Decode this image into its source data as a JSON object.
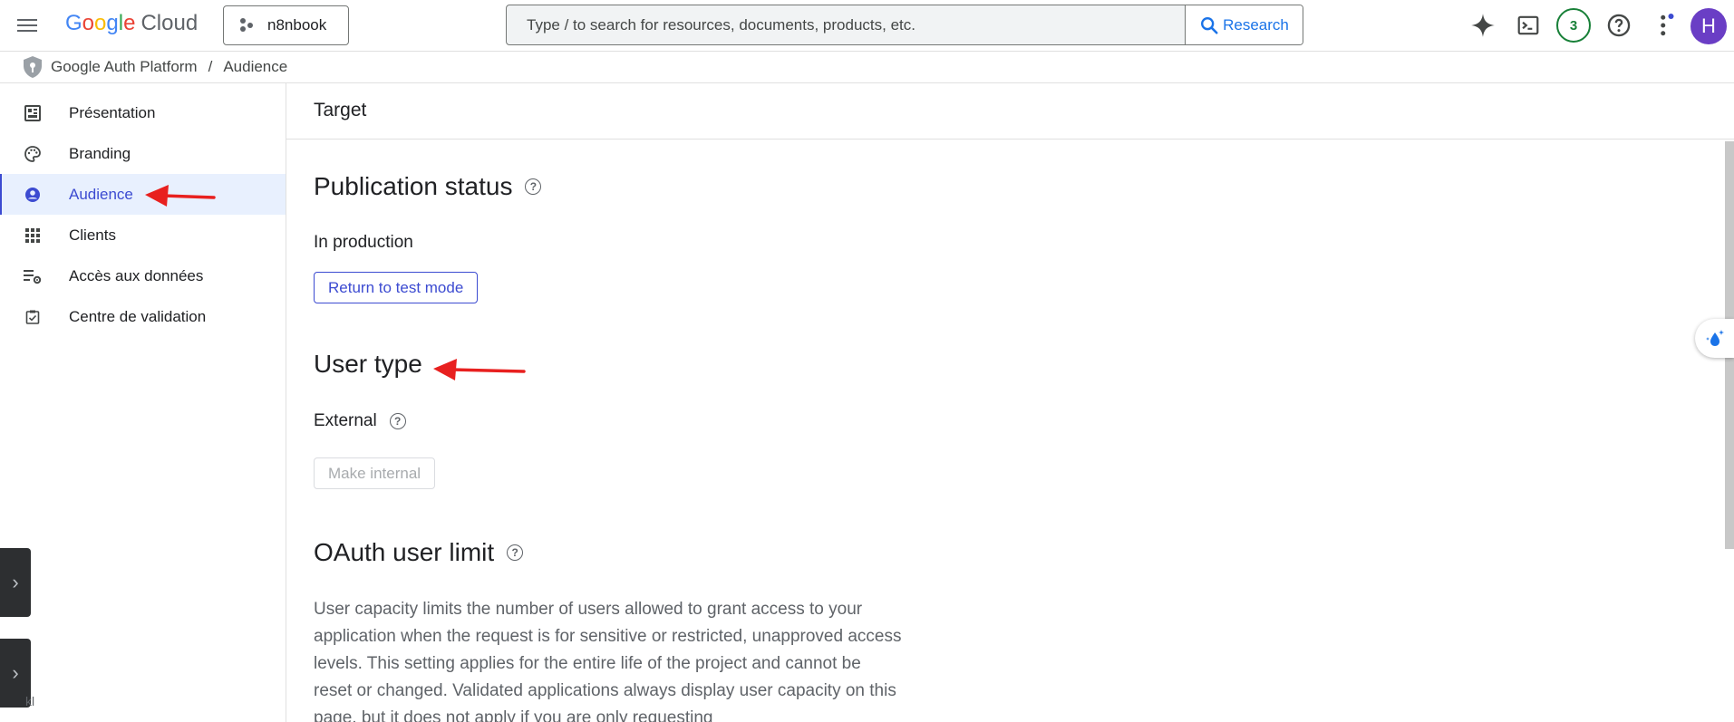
{
  "header": {
    "logo_parts": [
      "G",
      "o",
      "o",
      "g",
      "l",
      "e"
    ],
    "logo_suffix": "Cloud",
    "project_name": "n8nbook",
    "search_placeholder": "Type / to search for resources, documents, products, etc.",
    "search_button": "Research",
    "notification_count": "3",
    "avatar_initial": "H"
  },
  "breadcrumb": {
    "items": [
      "Google Auth Platform",
      "Audience"
    ],
    "separator": "/"
  },
  "sidebar": {
    "items": [
      {
        "label": "Présentation",
        "icon": "dashboard-icon",
        "active": false
      },
      {
        "label": "Branding",
        "icon": "palette-icon",
        "active": false
      },
      {
        "label": "Audience",
        "icon": "account-circle-icon",
        "active": true
      },
      {
        "label": "Clients",
        "icon": "apps-grid-icon",
        "active": false
      },
      {
        "label": "Accès aux données",
        "icon": "data-settings-icon",
        "active": false
      },
      {
        "label": "Centre de validation",
        "icon": "checklist-icon",
        "active": false
      }
    ],
    "bottom_fragment": "kl"
  },
  "main": {
    "tab": "Target",
    "publication": {
      "title": "Publication status",
      "status": "In production",
      "button": "Return to test mode"
    },
    "user_type": {
      "title": "User type",
      "value": "External",
      "button": "Make internal"
    },
    "oauth_limit": {
      "title": "OAuth user limit",
      "description": "User capacity limits the number of users allowed to grant access to your application when the request is for sensitive or restricted, unapproved access levels. This setting applies for the entire life of the project and cannot be reset or changed. Validated applications always display user capacity on this page, but it does not apply if you are only requesting"
    }
  },
  "colors": {
    "accent": "#3c4bd1",
    "active_bg": "#e8f0fe",
    "annotation_arrow": "#e8201f",
    "badge_green": "#188038",
    "avatar_purple": "#6a3ec5"
  }
}
